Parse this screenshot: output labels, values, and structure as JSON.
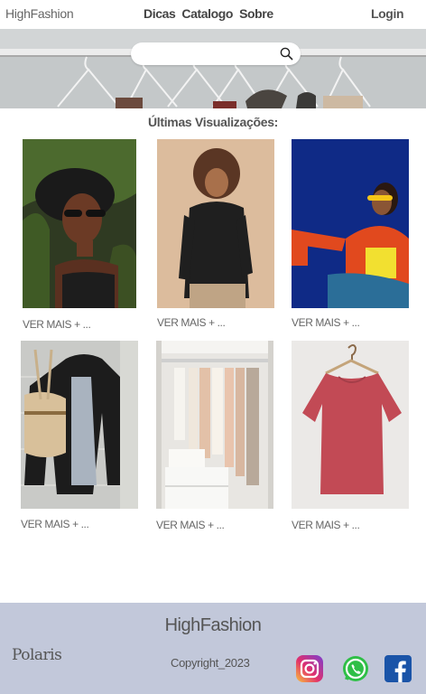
{
  "header": {
    "brand": "HighFashion",
    "nav": [
      "Dicas",
      "Catalogo",
      "Sobre"
    ],
    "login": "Login"
  },
  "hero": {
    "search_placeholder": "",
    "search_icon": "search-icon"
  },
  "recent": {
    "title": "Últimas Visualizações:",
    "items": [
      {
        "label": "VER MAIS + ...",
        "image": "woman-black-hat-sunglasses"
      },
      {
        "label": "VER MAIS + ...",
        "image": "woman-black-jacket-beige-background"
      },
      {
        "label": "VER MAIS + ...",
        "image": "woman-orange-jacket-blue-background"
      },
      {
        "label": "VER MAIS + ...",
        "image": "leather-jacket-bag-outfit"
      },
      {
        "label": "VER MAIS + ...",
        "image": "wardrobe-closet"
      },
      {
        "label": "VER MAIS + ...",
        "image": "pink-tshirt-hanger"
      }
    ]
  },
  "footer": {
    "brand": "HighFashion",
    "logo": "Polaris",
    "copyright": "Copyright_2023",
    "social": [
      "instagram-icon",
      "whatsapp-icon",
      "facebook-icon"
    ]
  },
  "colors": {
    "footer_bg": "#c2c8da",
    "text": "#555555",
    "facebook": "#1a54a8",
    "whatsapp": "#2fbf47"
  }
}
